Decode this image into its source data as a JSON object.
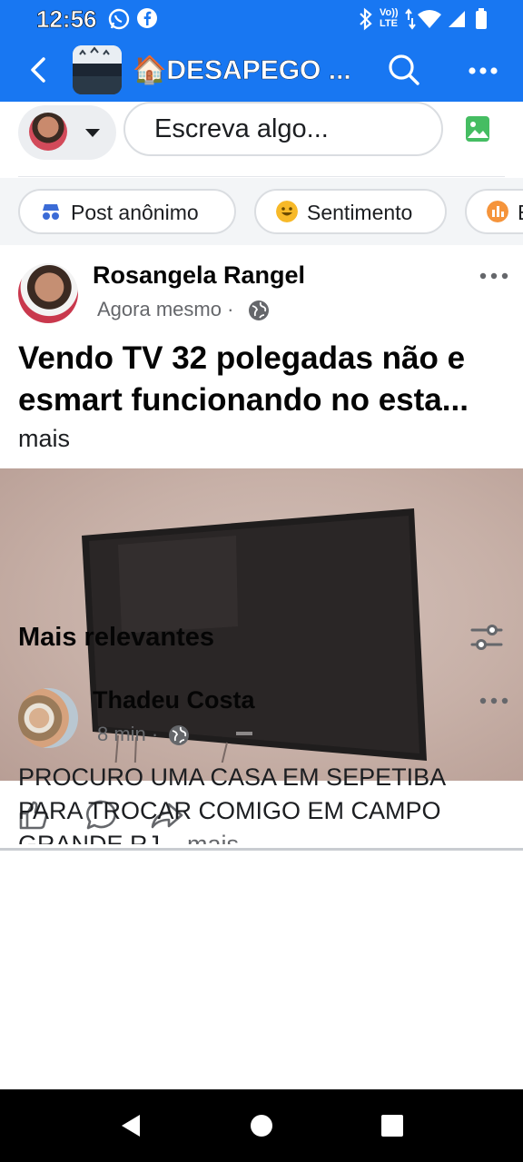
{
  "status": {
    "time": "12:56",
    "network": "LTE",
    "volte": "Vo))"
  },
  "header": {
    "group_title": "🏠DESAPEGO ..."
  },
  "composer": {
    "placeholder": "Escreva algo..."
  },
  "chips": [
    {
      "label": "Post anônimo",
      "icon": "incognito-icon"
    },
    {
      "label": "Sentimento",
      "icon": "smiley-icon"
    },
    {
      "label": "E",
      "icon": "poll-icon"
    }
  ],
  "post": {
    "author": "Rosangela Rangel",
    "time": "Agora mesmo",
    "separator": "·",
    "title_line1": "Vendo TV 32 polegadas não e",
    "title_line2": "esmart  funcionando no esta...",
    "more_label": "mais"
  },
  "comments": {
    "section_title": "Mais relevantes",
    "items": [
      {
        "author": "Thadeu Costa",
        "time": "8 min",
        "separator": "·",
        "line1": "PROCURO UMA CASA EM SEPETIBA",
        "line2": "PARA TROCAR COMIGO EM CAMPO",
        "line3": "GRANDE RJ...",
        "more_label": "mais"
      }
    ]
  },
  "colors": {
    "brand_blue": "#1877f2",
    "secondary_text": "#65676b"
  }
}
